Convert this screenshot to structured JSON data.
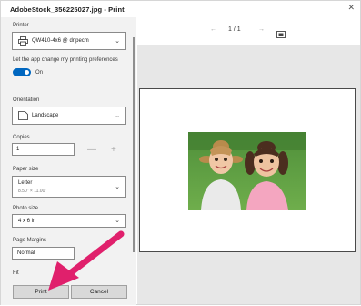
{
  "window": {
    "title": "AdobeStock_356225027.jpg - Print",
    "close_icon": "x-icon"
  },
  "settings": {
    "printer_label": "Printer",
    "printer_value": "QW410-4x6 @ dnpecm",
    "printer_icon": "printer-icon",
    "app_pref_label": "Let the app change my printing preferences",
    "toggle_state": "On",
    "orientation_label": "Orientation",
    "orientation_value": "Landscape",
    "orientation_icon": "landscape-page-icon",
    "copies_label": "Copies",
    "copies_value": "1",
    "stepper_minus": "—",
    "stepper_plus": "+",
    "paper_size_label": "Paper size",
    "paper_size_value": "Letter",
    "paper_size_sub": "8.50\" × 11.00\"",
    "photo_size_label": "Photo size",
    "photo_size_value": "4 x 6 in",
    "margins_label": "Page Margins",
    "margins_value": "Normal",
    "fit_label": "Fit"
  },
  "buttons": {
    "print": "Print",
    "cancel": "Cancel"
  },
  "preview": {
    "page_indicator": "1 / 1",
    "prev_icon": "chevron-left-icon",
    "next_icon": "chevron-right-icon",
    "fit_icon": "fit-page-icon",
    "image_subject": "two smiling girls with pigtails on grass"
  },
  "colors": {
    "accent": "#0067c0",
    "arrow": "#e0206c"
  }
}
